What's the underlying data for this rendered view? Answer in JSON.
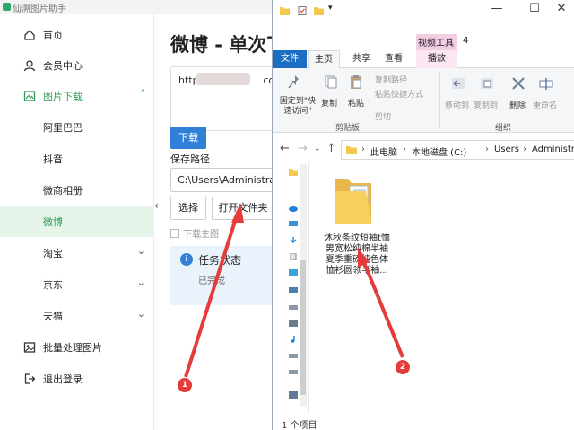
{
  "app": {
    "title": "仙溯图片助手",
    "sidebar": [
      {
        "label": "首页"
      },
      {
        "label": "会员中心"
      },
      {
        "label": "图片下载",
        "chevron": "˄"
      },
      {
        "label": "阿里巴巴"
      },
      {
        "label": "抖音"
      },
      {
        "label": "微商相册"
      },
      {
        "label": "微博"
      },
      {
        "label": "淘宝",
        "chevron": "⌄"
      },
      {
        "label": "京东",
        "chevron": "⌄"
      },
      {
        "label": "天猫",
        "chevron": "⌄"
      },
      {
        "label": "批量处理图片"
      },
      {
        "label": "退出登录"
      }
    ],
    "page_title": "微博 - 单次下",
    "url_text": "https",
    "url_tail": "com/u/",
    "download_label": "下载",
    "save_path_label": "保存路径",
    "save_path_value": "C:\\Users\\Administrator",
    "select_label": "选择",
    "open_folder_label": "打开文件夹",
    "download_main_label": "下载主图",
    "task_title": "任务状态",
    "task_status": "已完成",
    "collapse_glyph": "‹"
  },
  "explorer": {
    "context_tab": "视频工具",
    "context_num": "4",
    "window_buttons": [
      "—",
      "☐",
      "✕"
    ],
    "tabs": [
      "文件",
      "主页",
      "共享",
      "查看",
      "播放"
    ],
    "ribbon": {
      "pin_label": "固定到\"快速访问\"",
      "copy_label": "复制",
      "paste_label": "粘贴",
      "copy_path_label": "复制路径",
      "paste_shortcut_label": "粘贴快捷方式",
      "cut_label": "剪切",
      "clipboard_group": "剪贴板",
      "move_to_label": "移动到",
      "copy_to_label": "复制到",
      "delete_label": "删除",
      "rename_label": "重命名",
      "organize_group": "组织"
    },
    "breadcrumb": [
      "此电脑",
      "本地磁盘 (C:)",
      "Users",
      "Administrator"
    ],
    "breadcrumb_sep": "›",
    "folder_name": "沐秋条纹短袖t恤男宽松纯棉半袖夏季重磅纯色体恤衫圆领半袖...",
    "status_text": "1 个项目"
  },
  "annotations": [
    {
      "number": "1"
    },
    {
      "number": "2"
    }
  ],
  "colors": {
    "brand_green": "#2e9a58",
    "accent_blue": "#2f80d6",
    "annotation_red": "#e53b3b",
    "ribbon_blue": "#1b6ec2"
  }
}
